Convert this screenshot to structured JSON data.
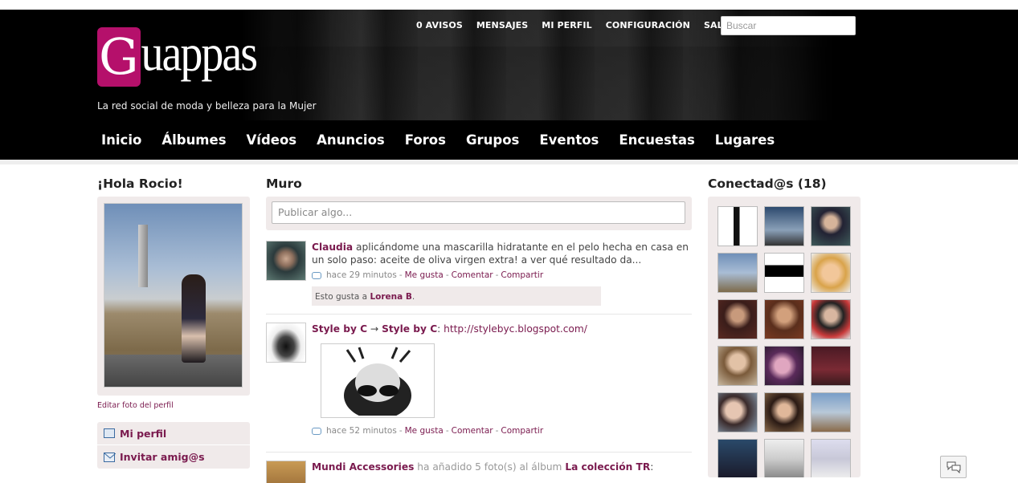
{
  "header": {
    "logo_g": "G",
    "logo_rest": "uappas",
    "tagline": "La red social de moda y belleza para la Mujer",
    "top_links": [
      "0 AVISOS",
      "MENSAJES",
      "MI PERFIL",
      "CONFIGURACIÓN",
      "SALIR"
    ],
    "search_placeholder": "Buscar",
    "main_nav": [
      "Inicio",
      "Álbumes",
      "Vídeos",
      "Anuncios",
      "Foros",
      "Grupos",
      "Eventos",
      "Encuestas",
      "Lugares"
    ]
  },
  "left": {
    "greeting": "¡Hola Rocio!",
    "edit_photo": "Editar foto del perfil",
    "menu": [
      {
        "label": "Mi perfil",
        "icon": "profile-icon"
      },
      {
        "label": "Invitar amig@s",
        "icon": "mail-icon"
      }
    ]
  },
  "wall": {
    "title": "Muro",
    "post_placeholder": "Publicar algo...",
    "items": [
      {
        "author": "Claudia",
        "text": " aplicándome una mascarilla hidratante en el pelo hecha en casa en un solo paso: aceite de oliva virgen extra! a ver qué resultado da...",
        "time": "hace 29 minutos",
        "actions": [
          "Me gusta",
          "Comentar",
          "Compartir"
        ],
        "likes_prefix": "Esto gusta a ",
        "likes_name": "Lorena B",
        "likes_suffix": "."
      },
      {
        "author": "Style by C",
        "arrow": " → ",
        "target": "Style by C",
        "colon": ": ",
        "link": "http://stylebyc.blogspot.com/",
        "time": "hace 52 minutos",
        "actions": [
          "Me gusta",
          "Comentar",
          "Compartir"
        ]
      },
      {
        "author": "Mundi Accessories",
        "text": " ha añadido 5 foto(s) al álbum ",
        "album": "La colección TR",
        "suffix": ":"
      }
    ]
  },
  "right": {
    "title": "Conectad@s (18)"
  },
  "colors": {
    "brand": "#b5106b",
    "link": "#7a1a4e",
    "panel": "#f0eaea"
  }
}
